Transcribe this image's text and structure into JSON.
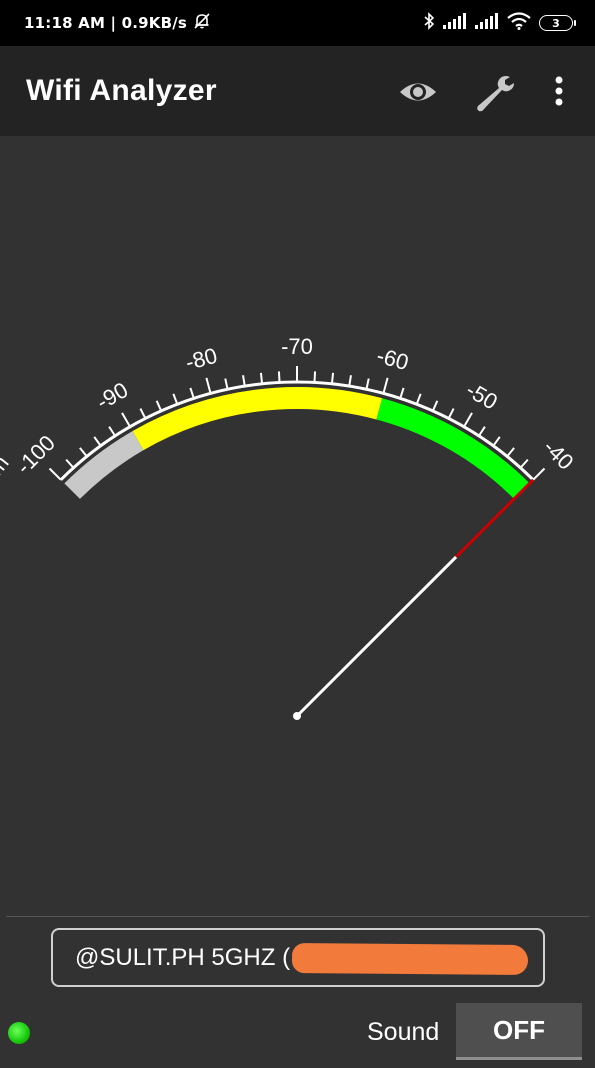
{
  "status_bar": {
    "time_speed": "11:18 AM | 0.9KB/s",
    "battery_level": "3"
  },
  "app_bar": {
    "title": "Wifi Analyzer",
    "icons": [
      "eye-icon",
      "wrench-icon",
      "overflow-menu-icon"
    ]
  },
  "gauge": {
    "unit_label": "dBm",
    "min": -100,
    "max": -40,
    "ticks": [
      "-100",
      "-90",
      "-80",
      "-70",
      "-60",
      "-50",
      "-40"
    ],
    "needle_value": -40,
    "bands": [
      {
        "from": -100,
        "to": -90,
        "color": "#c8c8c8"
      },
      {
        "from": -90,
        "to": -60,
        "color": "#ffff00"
      },
      {
        "from": -60,
        "to": -40,
        "color": "#00ff00"
      }
    ],
    "needle_color": "#ffffff",
    "needle_tip_color": "#cc0000"
  },
  "network": {
    "selected": "@SULIT.PH 5GHZ ("
  },
  "sound": {
    "label": "Sound",
    "toggle": "OFF"
  },
  "colors": {
    "background": "#323232",
    "app_bar": "#232323",
    "status_dot": "#16c80b"
  }
}
